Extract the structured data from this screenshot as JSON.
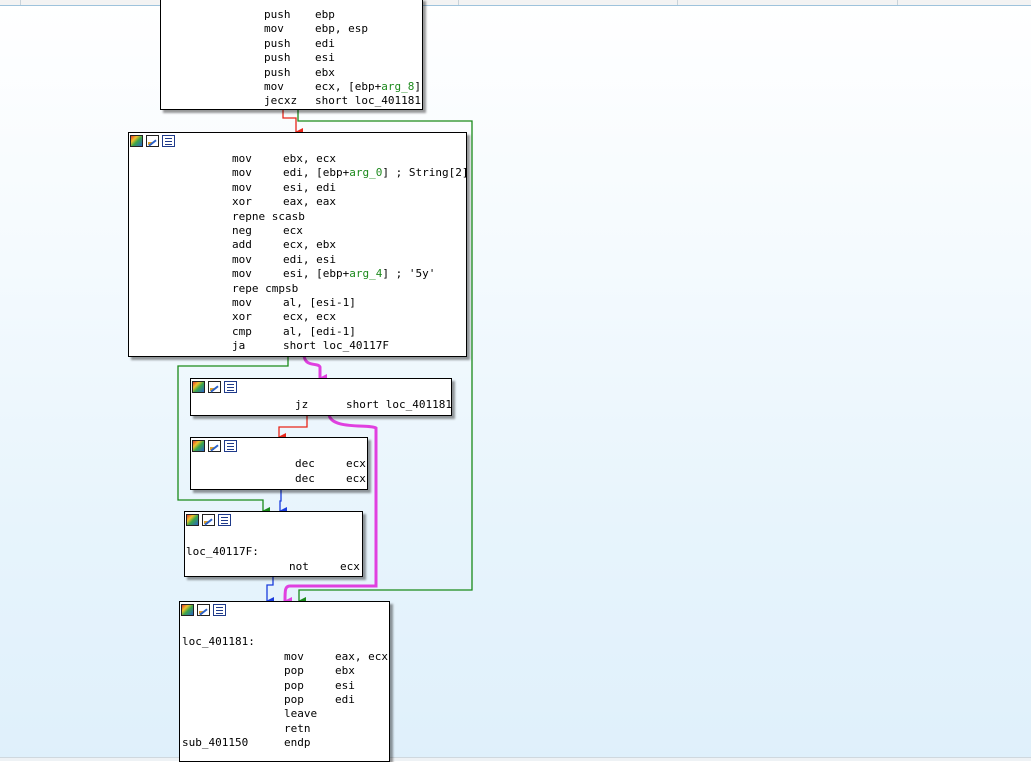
{
  "blocks": {
    "b1": {
      "lines": [
        {
          "mn": "push",
          "op": "ebp"
        },
        {
          "mn": "mov",
          "op": "ebp, esp"
        },
        {
          "mn": "push",
          "op": "edi"
        },
        {
          "mn": "push",
          "op": "esi"
        },
        {
          "mn": "push",
          "op": "ebx"
        },
        {
          "mn": "mov",
          "op_pre": "ecx, [ebp+",
          "op_arg": "arg_8",
          "op_post": "]"
        },
        {
          "mn": "jecxz",
          "op": "short loc_401181"
        }
      ]
    },
    "b2": {
      "lines": [
        {
          "mn": "mov",
          "op": "ebx, ecx"
        },
        {
          "mn": "mov",
          "op_pre": "edi, [ebp+",
          "op_arg": "arg_0",
          "op_post": "] ; String[2]"
        },
        {
          "mn": "mov",
          "op": "esi, edi"
        },
        {
          "mn": "xor",
          "op": "eax, eax"
        },
        {
          "mn": "repne scasb",
          "op": ""
        },
        {
          "mn": "neg",
          "op": "ecx"
        },
        {
          "mn": "add",
          "op": "ecx, ebx"
        },
        {
          "mn": "mov",
          "op": "edi, esi"
        },
        {
          "mn": "mov",
          "op_pre": "esi, [ebp+",
          "op_arg": "arg_4",
          "op_post": "] ; '5y'"
        },
        {
          "mn": "repe cmpsb",
          "op": ""
        },
        {
          "mn": "mov",
          "op": "al, [esi-1]"
        },
        {
          "mn": "xor",
          "op": "ecx, ecx"
        },
        {
          "mn": "cmp",
          "op": "al, [edi-1]"
        },
        {
          "mn": "ja",
          "op": "short loc_40117F"
        }
      ]
    },
    "b3": {
      "mn": "jz",
      "op": "short loc_401181"
    },
    "b4": {
      "lines": [
        {
          "mn": "dec",
          "op": "ecx"
        },
        {
          "mn": "dec",
          "op": "ecx"
        }
      ]
    },
    "b5": {
      "label": "loc_40117F:",
      "mn": "not",
      "op": "ecx"
    },
    "b6": {
      "label": "loc_401181:",
      "lines": [
        {
          "mn": "mov",
          "op": "eax, ecx"
        },
        {
          "mn": "pop",
          "op": "ebx"
        },
        {
          "mn": "pop",
          "op": "esi"
        },
        {
          "mn": "pop",
          "op": "edi"
        },
        {
          "mn": "leave",
          "op": ""
        },
        {
          "mn": "retn",
          "op": ""
        }
      ],
      "end_label": "sub_401150",
      "end_mn": "endp"
    }
  },
  "colors": {
    "edge_false": "#e8261a",
    "edge_true": "#1a8a1a",
    "edge_uncond": "#1a3cdc",
    "highlight": "#e040e0",
    "arg": "#1d8a1d"
  },
  "icons": [
    "color-graph-icon",
    "graph-overview-icon",
    "xref-list-icon"
  ]
}
